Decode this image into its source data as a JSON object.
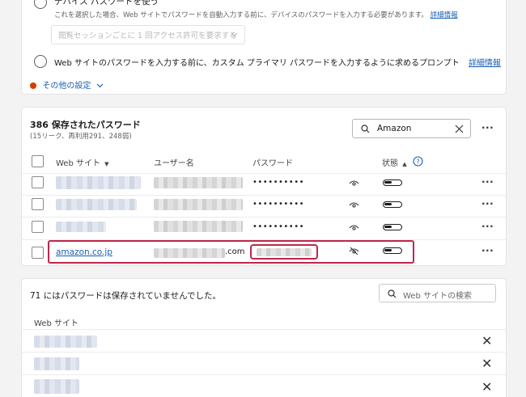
{
  "device_password": {
    "title": "デバイス パスワードを使う",
    "desc": "これを選択した場合、Web サイトでパスワードを自動入力する前に、デバイスのパスワードを入力する必要があります。",
    "link": "詳細情報",
    "dropdown": "閲覧セッションごとに 1 回アクセス許可を要求する"
  },
  "custom_password": {
    "title": "Web サイトのパスワードを入力する前に、カスタム プライマリ パスワードを入力するように求めるプロンプト",
    "link": "詳細情報"
  },
  "more_settings": "その他の設定",
  "saved": {
    "title": "386 保存されたパスワード",
    "subtitle": "(15リーク、再利用291、248弱)",
    "search_value": "Amazon",
    "columns": {
      "website": "Web サイト",
      "username": "ユーザー名",
      "password": "パスワード",
      "status": "状態"
    },
    "rows": [
      {
        "password": "••••••••••"
      },
      {
        "password": "••••••••••"
      },
      {
        "password": "••••••••••"
      },
      {
        "site": "amazon.co.jp",
        "username_suffix": ".com"
      }
    ]
  },
  "never_saved": {
    "title": "71 にはパスワードは保存されていませんでした。",
    "search_placeholder": "Web サイトの検索",
    "column": "Web サイト"
  },
  "colors": {
    "accent": "#1a5fb4",
    "highlight": "#c0264b",
    "warning": "#d83b01"
  }
}
